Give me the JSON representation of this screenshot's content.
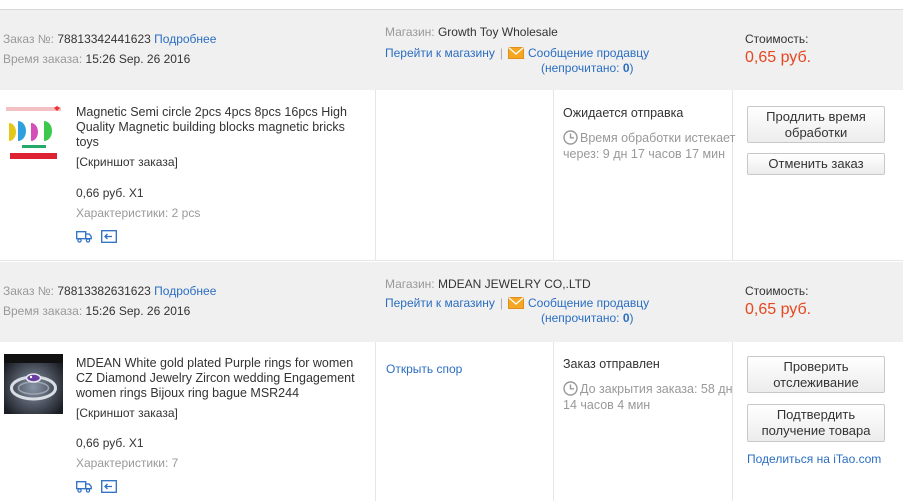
{
  "labels": {
    "order_no": "Заказ №:",
    "details": "Подробнее",
    "order_time": "Время заказа:",
    "store": "Магазин:",
    "goto_store": "Перейти к магазину",
    "message_seller": "Сообщение продавцу",
    "unread_prefix": "(непрочитано: ",
    "unread_suffix": ")",
    "cost": "Стоимость:",
    "snapshot": "[Скриншот заказа]",
    "specs": "Характеристики:"
  },
  "orders": [
    {
      "number": "78813342441623",
      "time": "15:26 Sep. 26 2016",
      "store": "Growth Toy Wholesale",
      "unread": "0",
      "cost": "0,65 руб.",
      "product_title": "Magnetic Semi circle 2pcs 4pcs 8pcs 16pcs High Quality Magnetic building blocks magnetic bricks toys",
      "qty_price": "0,66 руб. X1",
      "specs_value": "2 pcs",
      "status": "Ожидается отправка",
      "status_detail": "Время обработки истекает через: 9 дн 17 часов 17 мин",
      "buttons": [
        "Продлить время обработки",
        "Отменить заказ"
      ]
    },
    {
      "number": "78813382631623",
      "time": "15:26 Sep. 26 2016",
      "store": "MDEAN JEWELRY CO,.LTD",
      "unread": "0",
      "cost": "0,65 руб.",
      "product_title": "MDEAN White gold plated Purple rings for women CZ Diamond Jewelry Zircon wedding Engagement women rings Bijoux ring bague MSR244",
      "qty_price": "0,66 руб. X1",
      "specs_value": "7",
      "dispute_link": "Открыть спор",
      "status": "Заказ отправлен",
      "status_detail": "До закрытия заказа: 58 дн 14 часов 4 мин",
      "buttons": [
        "Проверить отслеживание",
        "Подтвердить получение товара"
      ],
      "share_prefix": "Поделиться на ",
      "share_site": "iTao.com"
    }
  ],
  "colors": {
    "link": "#2b6ec1",
    "price": "#e5471f",
    "header_bg": "#f0f0f0",
    "mail_icon": "#f5a623"
  }
}
